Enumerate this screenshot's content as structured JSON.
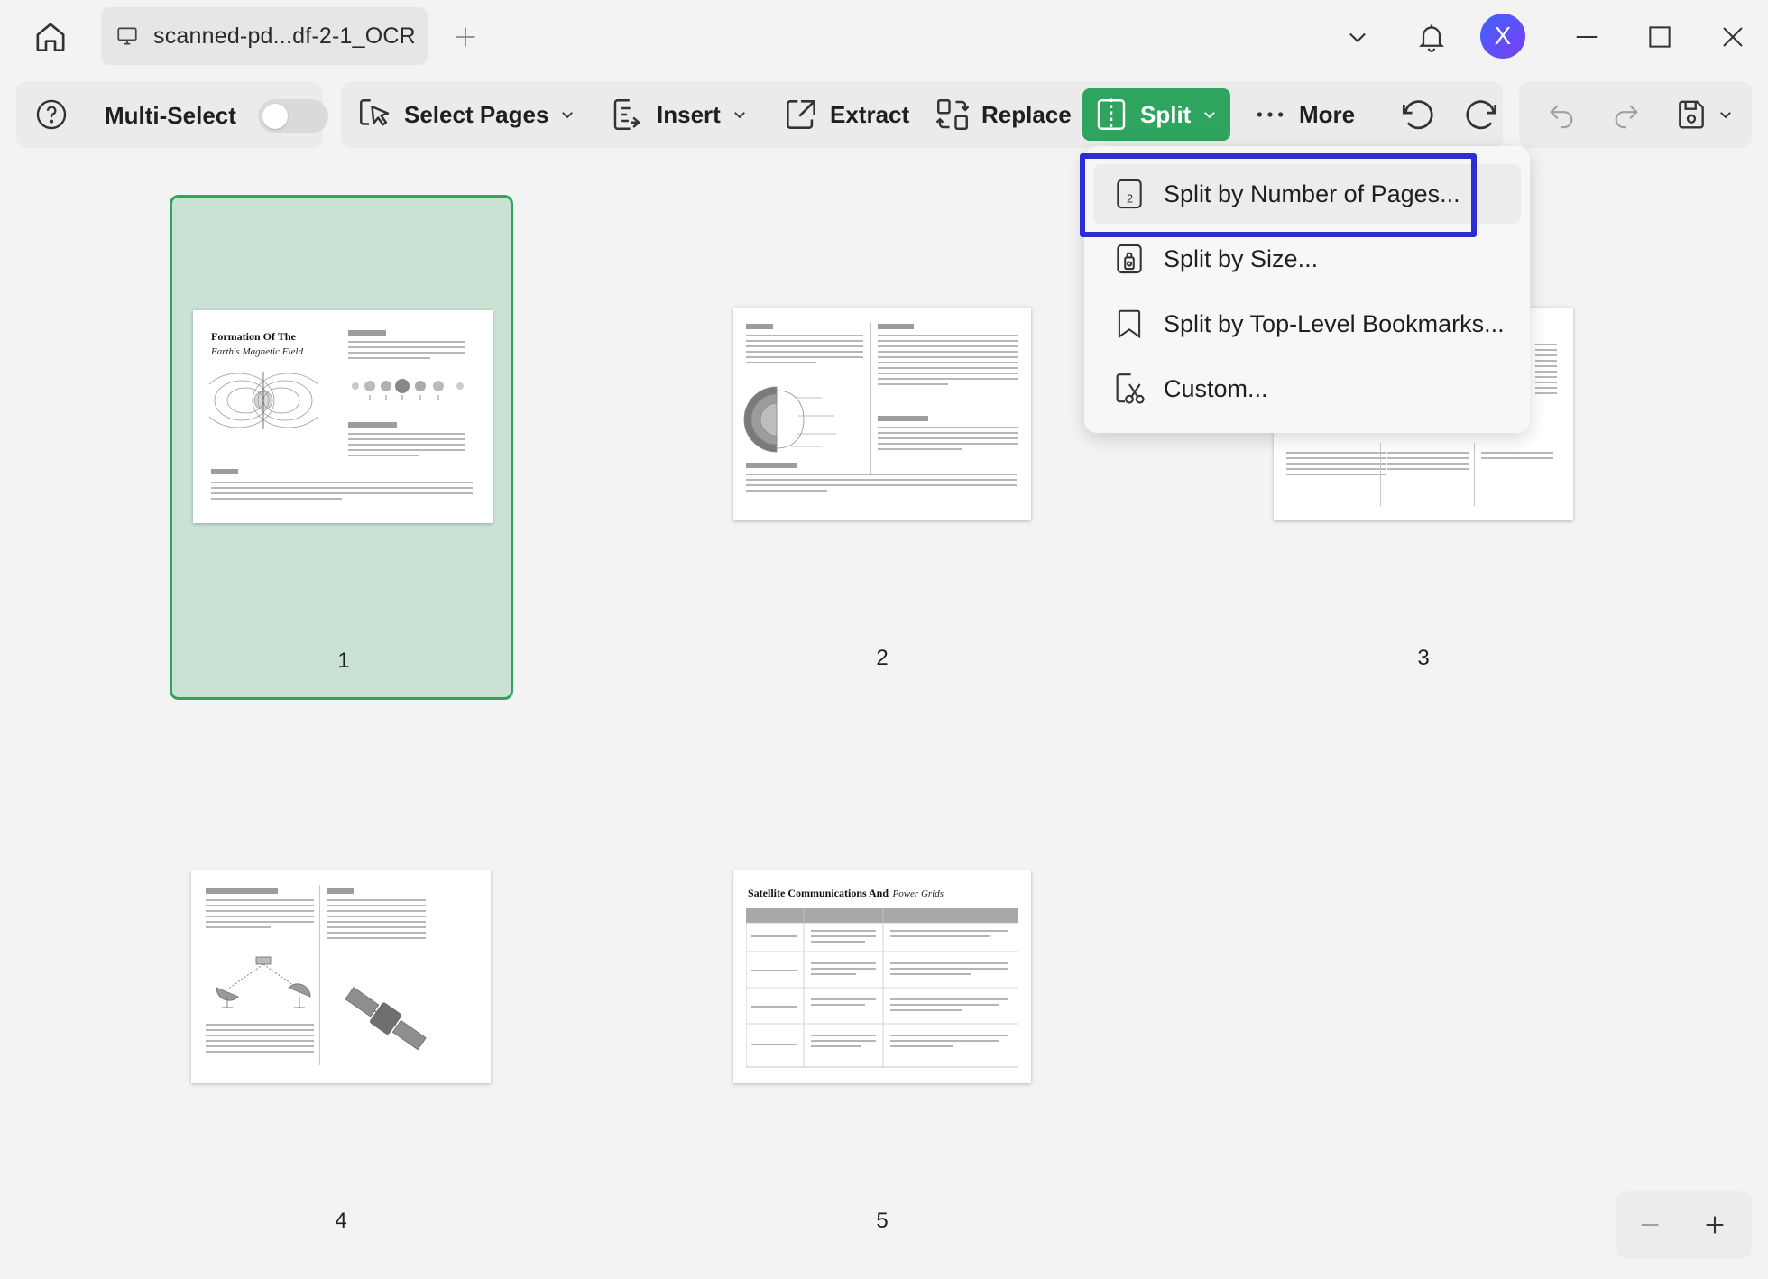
{
  "titlebar": {
    "tab_title": "scanned-pd...df-2-1_OCR",
    "avatar_letter": "X"
  },
  "toolbar": {
    "multi_select_label": "Multi-Select",
    "multi_select_on": false,
    "select_pages_label": "Select Pages",
    "insert_label": "Insert",
    "extract_label": "Extract",
    "replace_label": "Replace",
    "split_label": "Split",
    "more_label": "More"
  },
  "split_menu": {
    "items": [
      {
        "label": "Split by Number of Pages...",
        "icon": "number-pages-icon",
        "badge": "2"
      },
      {
        "label": "Split by Size...",
        "icon": "size-icon"
      },
      {
        "label": "Split by Top-Level Bookmarks...",
        "icon": "bookmark-icon"
      },
      {
        "label": "Custom...",
        "icon": "scissors-icon"
      }
    ]
  },
  "pages": [
    {
      "number": "1",
      "selected": true,
      "title": "Formation Of The",
      "subtitle": "Earth's Magnetic Field"
    },
    {
      "number": "2",
      "selected": false
    },
    {
      "number": "3",
      "selected": false
    },
    {
      "number": "4",
      "selected": false
    },
    {
      "number": "5",
      "selected": false,
      "title": "Satellite Communications And",
      "title_italic": "Power Grids"
    }
  ],
  "colors": {
    "accent": "#2fa45f",
    "selection_bg": "#c9e2d4",
    "focus_outline": "#2d2ecf",
    "avatar": "#5b50f5"
  }
}
